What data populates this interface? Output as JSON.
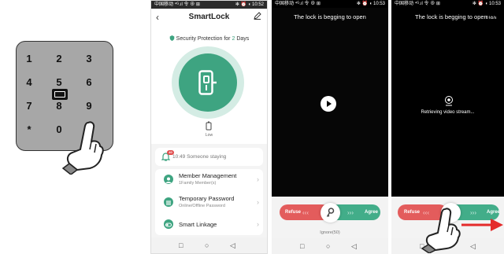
{
  "keypad": {
    "keys": [
      "1",
      "2",
      "3",
      "4",
      "5",
      "6",
      "7",
      "8",
      "9",
      "*",
      "0",
      "#"
    ]
  },
  "phone1": {
    "status_left": "中国移动 ⁴ᴳ.ıl 令 ⊕ ⊞",
    "status_right": "✻ ⏰ ◖ 10:52",
    "title": "SmartLock",
    "back": "‹",
    "security_prefix": "Security Protection for ",
    "security_days": "2",
    "security_suffix": " Days",
    "battery_label": "Low",
    "notification_badge": "40",
    "notification_text": "10:49 Someone staying",
    "menu": [
      {
        "title": "Member Management",
        "subtitle": "1Family Member(s)"
      },
      {
        "title": "Temporary Password",
        "subtitle": "Online/Offline Password"
      },
      {
        "title": "Smart Linkage",
        "subtitle": ""
      }
    ],
    "chevron": "›"
  },
  "phone2": {
    "status_left": "中国移动 ⁴ᴳ.ıl 令 ⊕ ⊞",
    "status_right": "✻ ⏰ ◖ 10:53",
    "title": "The lock is begging to open",
    "refuse": "Refuse",
    "agree": "Agree",
    "arrows_left": "‹‹‹",
    "arrows_right": "›››",
    "ignore": "Ignore(50)"
  },
  "phone3": {
    "status_left": "中国移动 ⁴ᴳ.ıl 令 ⊕ ⊞",
    "status_right": "✻ ⏰ ◖ 10:53",
    "title": "The lock is begging to open",
    "speed": "0 kb/s",
    "retrieving": "Retrieving video stream...",
    "refuse": "Refuse",
    "agree": "Agree",
    "arrows_left": "‹‹‹",
    "arrows_right": "›››",
    "ignore": "gnore"
  },
  "nav": {
    "back": "◁",
    "home": "○",
    "recent": "□"
  },
  "colors": {
    "accent": "#3ea481",
    "refuse": "#e35c5c",
    "agree": "#42ad89",
    "arrow": "#e42b2b"
  }
}
